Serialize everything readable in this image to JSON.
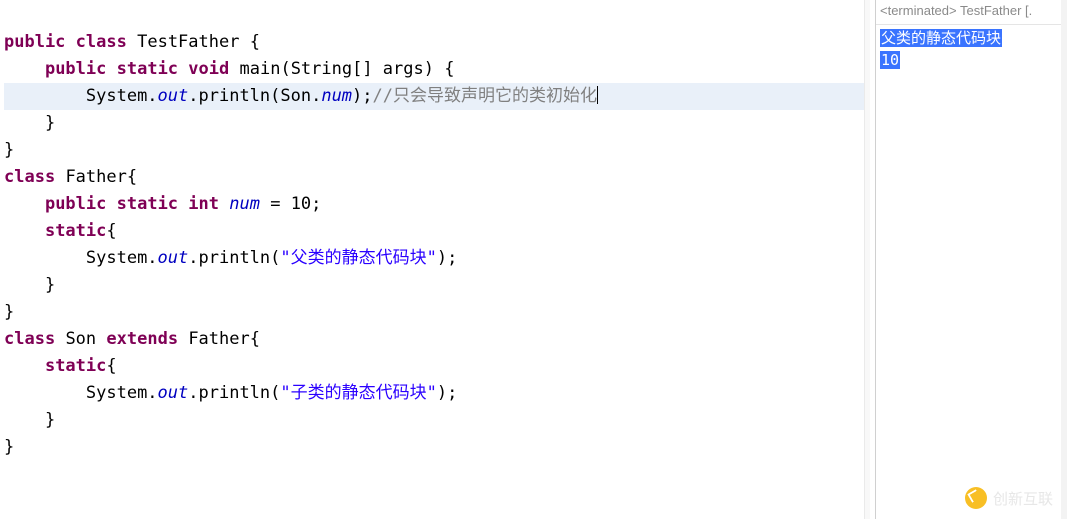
{
  "code": {
    "l1": {
      "kw1": "public",
      "kw2": "class",
      "name": "TestFather",
      "brace": "{"
    },
    "l2": {
      "kw1": "public",
      "kw2": "static",
      "kw3": "void",
      "name": "main",
      "params": "(String[] args)",
      "brace": "{"
    },
    "l3": {
      "pre": "System.",
      "out": "out",
      "mid": ".println(Son.",
      "num": "num",
      "post": ");",
      "comment": "//只会导致声明它的类初始化"
    },
    "l4": "    }",
    "l5": "}",
    "l6": {
      "kw1": "class",
      "name": "Father",
      "brace": "{"
    },
    "l7": {
      "kw1": "public",
      "kw2": "static",
      "kw3": "int",
      "field": "num",
      "rest": " = 10;"
    },
    "l8": {
      "kw1": "static",
      "brace": "{"
    },
    "l9": {
      "pre": "System.",
      "out": "out",
      "mid": ".println(",
      "str": "\"父类的静态代码块\"",
      "post": ");"
    },
    "l10": "    }",
    "l11": "}",
    "l12": {
      "kw1": "class",
      "name": "Son",
      "kw2": "extends",
      "parent": "Father",
      "brace": "{"
    },
    "l13": {
      "kw1": "static",
      "brace": "{"
    },
    "l14": {
      "pre": "System.",
      "out": "out",
      "mid": ".println(",
      "str": "\"子类的静态代码块\"",
      "post": ");"
    },
    "l15": "    }",
    "l16": "}"
  },
  "console": {
    "header": "<terminated> TestFather [.",
    "line1": "父类的静态代码块",
    "line2": "10"
  },
  "watermark": "创新互联"
}
